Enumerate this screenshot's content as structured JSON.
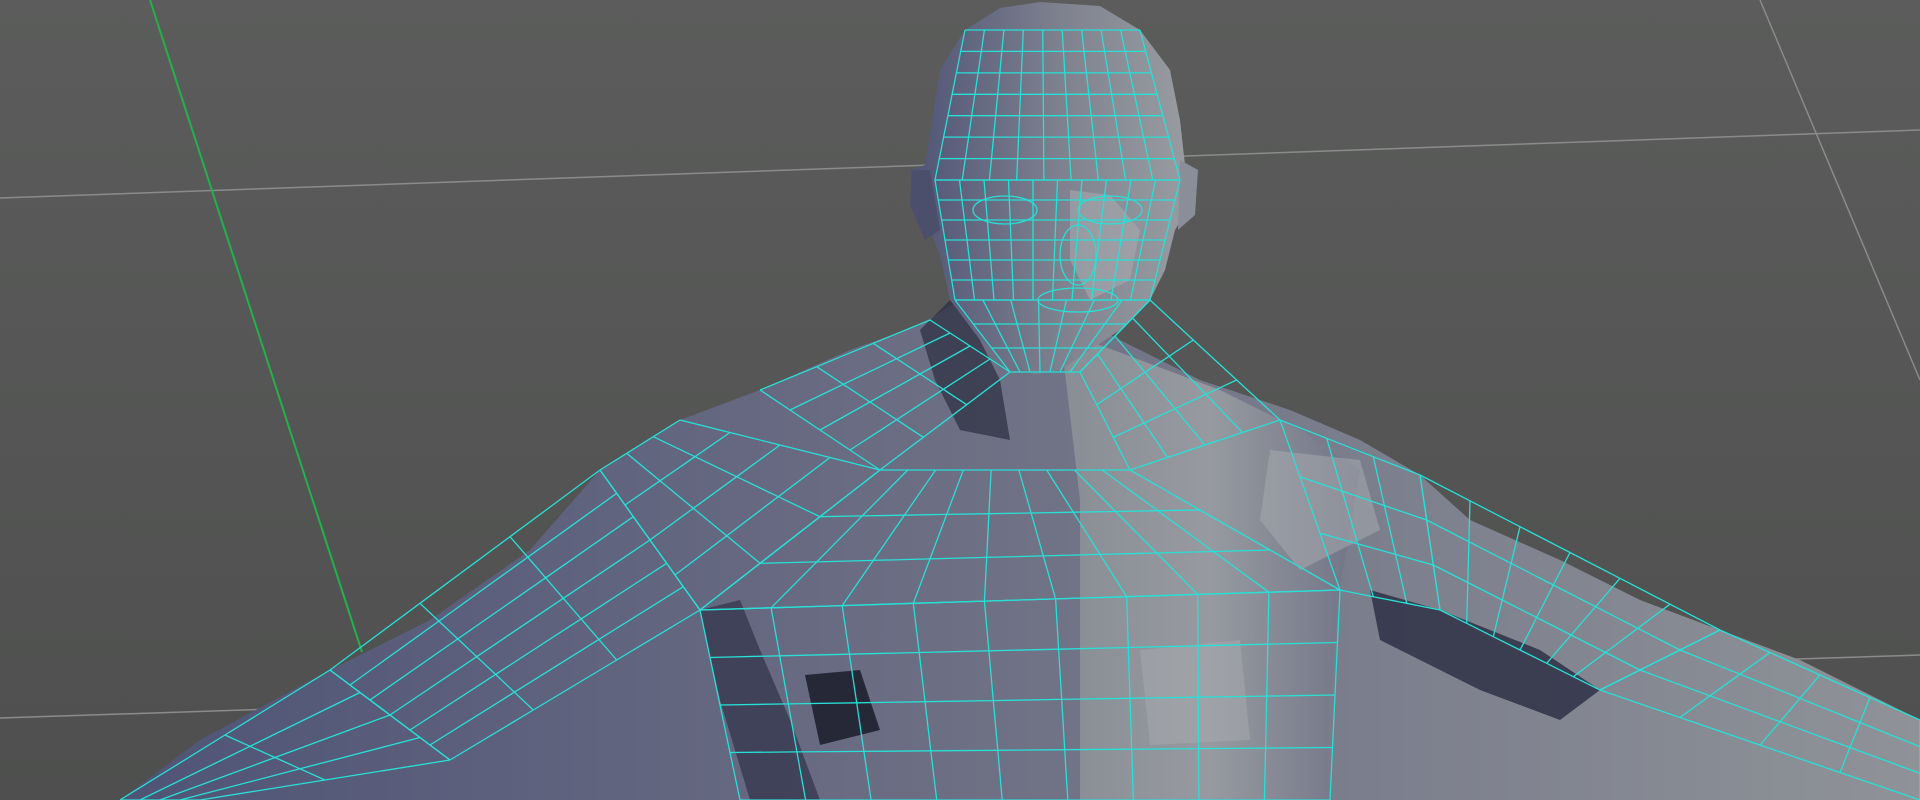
{
  "viewport": {
    "background_color": "#545554",
    "background_top_color": "#5b5c5b",
    "background_bottom_color": "#4e4f4e",
    "grid_line_color": "#8a8b8a",
    "axis_line_color": "#22b14c",
    "wireframe_color": "#27e0d6",
    "shade_light_color": "#a0a5a8",
    "shade_mid_color": "#6f7185",
    "shade_dark_color": "#2b2d3e",
    "shade_blue_color": "#4f5476"
  },
  "model": {
    "icon": "polygon-mesh-icon",
    "selection_state": "selected"
  }
}
